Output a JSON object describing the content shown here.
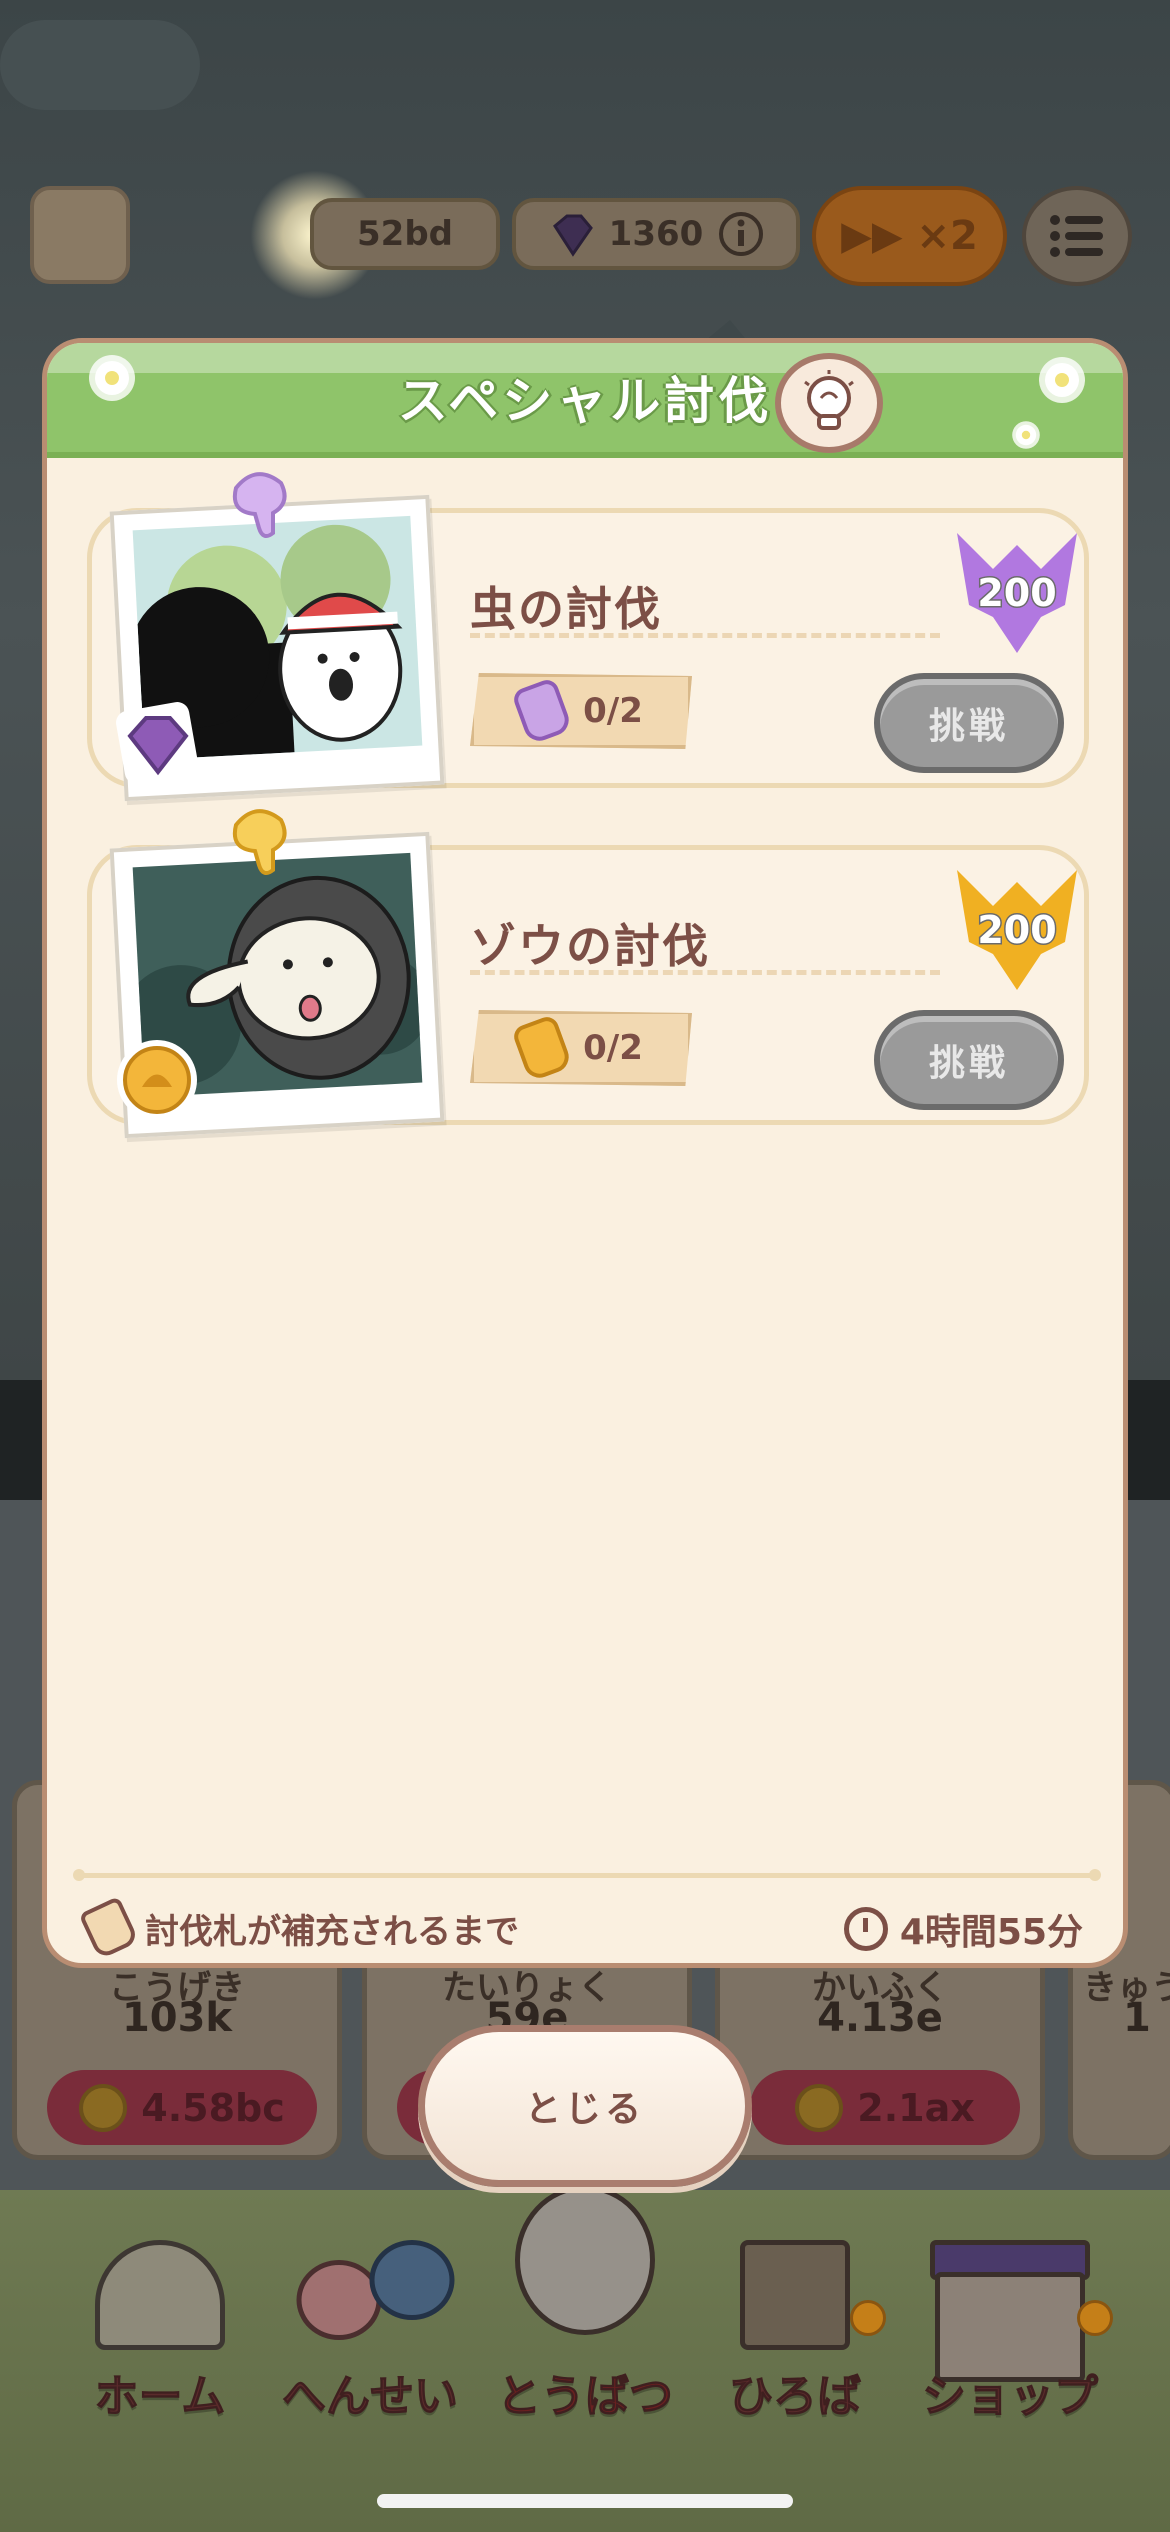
{
  "top_bar": {
    "coin_value": "52bd",
    "gem_value": "1360",
    "speed_label": "▶▶ ×2"
  },
  "stats": [
    {
      "label": "こうげき",
      "value": "103k",
      "cost": "4.58bc"
    },
    {
      "label": "たいりょく",
      "value": "59e",
      "cost": ""
    },
    {
      "label": "かいふく",
      "value": "4.13e",
      "cost": "2.1ax"
    },
    {
      "label": "きゅう",
      "value": "1",
      "cost": ""
    }
  ],
  "modal": {
    "title": "スペシャル討伐",
    "missions": [
      {
        "name": "虫の討伐",
        "tickets": "0/2",
        "reward": "200",
        "button": "挑戦",
        "reward_color": "#b178e0",
        "ticket_color": "#c9a4e6"
      },
      {
        "name": "ゾウの討伐",
        "tickets": "0/2",
        "reward": "200",
        "button": "挑戦",
        "reward_color": "#f0b022",
        "ticket_color": "#f3b63a"
      }
    ],
    "footer_left": "討伐札が補充されるまで",
    "footer_right": "4時間55分",
    "close_label": "とじる"
  },
  "bottom_nav": [
    {
      "label": "ホーム"
    },
    {
      "label": "へんせい"
    },
    {
      "label": "とうばつ"
    },
    {
      "label": "ひろば"
    },
    {
      "label": "ショップ"
    }
  ],
  "icons": {
    "hint": "lightbulb-icon",
    "ticket": "ticket-icon",
    "timer": "stopwatch-icon",
    "gem": "gem-icon",
    "coin": "coin-icon"
  }
}
